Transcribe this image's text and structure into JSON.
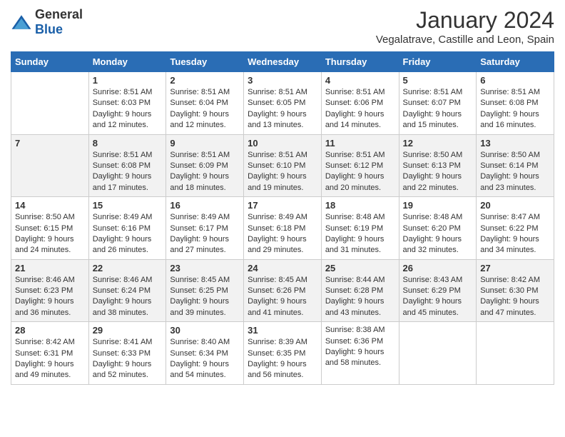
{
  "logo": {
    "general": "General",
    "blue": "Blue"
  },
  "title": "January 2024",
  "subtitle": "Vegalatrave, Castille and Leon, Spain",
  "days_of_week": [
    "Sunday",
    "Monday",
    "Tuesday",
    "Wednesday",
    "Thursday",
    "Friday",
    "Saturday"
  ],
  "weeks": [
    [
      {
        "day": "",
        "info": ""
      },
      {
        "day": "1",
        "info": "Sunrise: 8:51 AM\nSunset: 6:03 PM\nDaylight: 9 hours\nand 12 minutes."
      },
      {
        "day": "2",
        "info": "Sunrise: 8:51 AM\nSunset: 6:04 PM\nDaylight: 9 hours\nand 12 minutes."
      },
      {
        "day": "3",
        "info": "Sunrise: 8:51 AM\nSunset: 6:05 PM\nDaylight: 9 hours\nand 13 minutes."
      },
      {
        "day": "4",
        "info": "Sunrise: 8:51 AM\nSunset: 6:06 PM\nDaylight: 9 hours\nand 14 minutes."
      },
      {
        "day": "5",
        "info": "Sunrise: 8:51 AM\nSunset: 6:07 PM\nDaylight: 9 hours\nand 15 minutes."
      },
      {
        "day": "6",
        "info": "Sunrise: 8:51 AM\nSunset: 6:08 PM\nDaylight: 9 hours\nand 16 minutes."
      }
    ],
    [
      {
        "day": "7",
        "info": ""
      },
      {
        "day": "8",
        "info": "Sunrise: 8:51 AM\nSunset: 6:08 PM\nDaylight: 9 hours\nand 17 minutes."
      },
      {
        "day": "9",
        "info": "Sunrise: 8:51 AM\nSunset: 6:09 PM\nDaylight: 9 hours\nand 18 minutes."
      },
      {
        "day": "10",
        "info": "Sunrise: 8:51 AM\nSunset: 6:10 PM\nDaylight: 9 hours\nand 19 minutes."
      },
      {
        "day": "11",
        "info": "Sunrise: 8:51 AM\nSunset: 6:12 PM\nDaylight: 9 hours\nand 20 minutes."
      },
      {
        "day": "12",
        "info": "Sunrise: 8:50 AM\nSunset: 6:13 PM\nDaylight: 9 hours\nand 22 minutes."
      },
      {
        "day": "13",
        "info": "Sunrise: 8:50 AM\nSunset: 6:14 PM\nDaylight: 9 hours\nand 23 minutes."
      }
    ],
    [
      {
        "day": "14",
        "info": "Sunrise: 8:50 AM\nSunset: 6:15 PM\nDaylight: 9 hours\nand 24 minutes."
      },
      {
        "day": "15",
        "info": "Sunrise: 8:49 AM\nSunset: 6:16 PM\nDaylight: 9 hours\nand 26 minutes."
      },
      {
        "day": "16",
        "info": "Sunrise: 8:49 AM\nSunset: 6:17 PM\nDaylight: 9 hours\nand 27 minutes."
      },
      {
        "day": "17",
        "info": "Sunrise: 8:49 AM\nSunset: 6:18 PM\nDaylight: 9 hours\nand 29 minutes."
      },
      {
        "day": "18",
        "info": "Sunrise: 8:48 AM\nSunset: 6:19 PM\nDaylight: 9 hours\nand 31 minutes."
      },
      {
        "day": "19",
        "info": "Sunrise: 8:48 AM\nSunset: 6:20 PM\nDaylight: 9 hours\nand 32 minutes."
      },
      {
        "day": "20",
        "info": "Sunrise: 8:47 AM\nSunset: 6:22 PM\nDaylight: 9 hours\nand 34 minutes."
      }
    ],
    [
      {
        "day": "21",
        "info": "Sunrise: 8:46 AM\nSunset: 6:23 PM\nDaylight: 9 hours\nand 36 minutes."
      },
      {
        "day": "22",
        "info": "Sunrise: 8:46 AM\nSunset: 6:24 PM\nDaylight: 9 hours\nand 38 minutes."
      },
      {
        "day": "23",
        "info": "Sunrise: 8:45 AM\nSunset: 6:25 PM\nDaylight: 9 hours\nand 39 minutes."
      },
      {
        "day": "24",
        "info": "Sunrise: 8:45 AM\nSunset: 6:26 PM\nDaylight: 9 hours\nand 41 minutes."
      },
      {
        "day": "25",
        "info": "Sunrise: 8:44 AM\nSunset: 6:28 PM\nDaylight: 9 hours\nand 43 minutes."
      },
      {
        "day": "26",
        "info": "Sunrise: 8:43 AM\nSunset: 6:29 PM\nDaylight: 9 hours\nand 45 minutes."
      },
      {
        "day": "27",
        "info": "Sunrise: 8:42 AM\nSunset: 6:30 PM\nDaylight: 9 hours\nand 47 minutes."
      }
    ],
    [
      {
        "day": "28",
        "info": "Sunrise: 8:42 AM\nSunset: 6:31 PM\nDaylight: 9 hours\nand 49 minutes."
      },
      {
        "day": "29",
        "info": "Sunrise: 8:41 AM\nSunset: 6:33 PM\nDaylight: 9 hours\nand 52 minutes."
      },
      {
        "day": "30",
        "info": "Sunrise: 8:40 AM\nSunset: 6:34 PM\nDaylight: 9 hours\nand 54 minutes."
      },
      {
        "day": "31",
        "info": "Sunrise: 8:39 AM\nSunset: 6:35 PM\nDaylight: 9 hours\nand 56 minutes."
      },
      {
        "day": "",
        "info": "Sunrise: 8:38 AM\nSunset: 6:36 PM\nDaylight: 9 hours\nand 58 minutes."
      },
      {
        "day": "",
        "info": ""
      },
      {
        "day": "",
        "info": ""
      }
    ]
  ]
}
